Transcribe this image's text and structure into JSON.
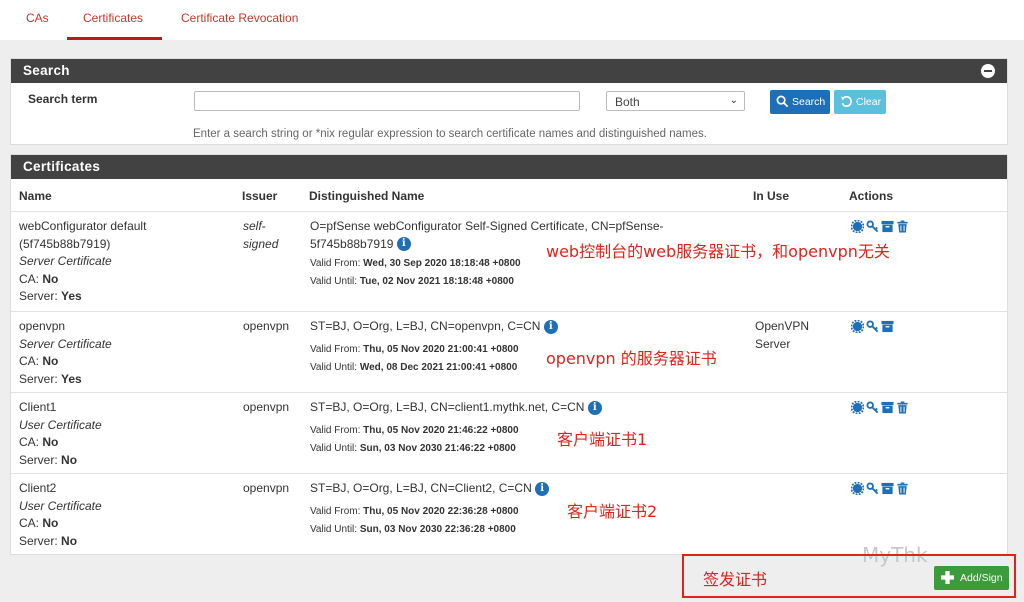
{
  "tabs": [
    {
      "label": "CAs"
    },
    {
      "label": "Certificates"
    },
    {
      "label": "Certificate Revocation"
    }
  ],
  "search": {
    "title": "Search",
    "term_label": "Search term",
    "input_value": "",
    "select_value": "Both",
    "search_button": "Search",
    "clear_button": "Clear",
    "help": "Enter a search string or *nix regular expression to search certificate names and distinguished names."
  },
  "certificates": {
    "title": "Certificates",
    "columns": [
      "Name",
      "Issuer",
      "Distinguished Name",
      "In Use",
      "Actions"
    ],
    "rows": [
      {
        "name": "webConfigurator default (5f745b88b7919)",
        "type": "Server Certificate",
        "ca_label": "CA:",
        "ca": "No",
        "server_label": "Server:",
        "server": "Yes",
        "issuer": "self-signed",
        "dn": "O=pfSense webConfigurator Self-Signed Certificate, CN=pfSense-5f745b88b7919",
        "valid_from_label": "Valid From:",
        "valid_from": "Wed, 30 Sep 2020 18:18:48 +0800",
        "valid_until_label": "Valid Until:",
        "valid_until": "Tue, 02 Nov 2021 18:18:48 +0800",
        "in_use": ""
      },
      {
        "name": "openvpn",
        "type": "Server Certificate",
        "ca_label": "CA:",
        "ca": "No",
        "server_label": "Server:",
        "server": "Yes",
        "issuer": "openvpn",
        "dn": "ST=BJ, O=Org, L=BJ, CN=openvpn, C=CN",
        "valid_from_label": "Valid From:",
        "valid_from": "Thu, 05 Nov 2020 21:00:41 +0800",
        "valid_until_label": "Valid Until:",
        "valid_until": "Wed, 08 Dec 2021 21:00:41 +0800",
        "in_use": "OpenVPN Server"
      },
      {
        "name": "Client1",
        "type": "User Certificate",
        "ca_label": "CA:",
        "ca": "No",
        "server_label": "Server:",
        "server": "No",
        "issuer": "openvpn",
        "dn": "ST=BJ, O=Org, L=BJ, CN=client1.mythk.net, C=CN",
        "valid_from_label": "Valid From:",
        "valid_from": "Thu, 05 Nov 2020 21:46:22 +0800",
        "valid_until_label": "Valid Until:",
        "valid_until": "Sun, 03 Nov 2030 21:46:22 +0800",
        "in_use": ""
      },
      {
        "name": "Client2",
        "type": "User Certificate",
        "ca_label": "CA:",
        "ca": "No",
        "server_label": "Server:",
        "server": "No",
        "issuer": "openvpn",
        "dn": "ST=BJ, O=Org, L=BJ, CN=Client2, C=CN",
        "valid_from_label": "Valid From:",
        "valid_from": "Thu, 05 Nov 2020 22:36:28 +0800",
        "valid_until_label": "Valid Until:",
        "valid_until": "Sun, 03 Nov 2030 22:36:28 +0800",
        "in_use": ""
      }
    ]
  },
  "annotations": {
    "row1": "web控制台的web服务器证书，和openvpn无关",
    "row2": "openvpn 的服务器证书",
    "row3": "客户端证书1",
    "row4": "客户端证书2",
    "sign": "签发证书"
  },
  "add_button": "Add/Sign",
  "watermark": "MyThk",
  "info_glyph": "i",
  "colors": {
    "tab_active": "#c0392b",
    "header_bg": "#424242",
    "primary": "#1e6fb7",
    "info": "#5bc0de",
    "success": "#3c9b3c",
    "annotation": "#e2231a"
  }
}
